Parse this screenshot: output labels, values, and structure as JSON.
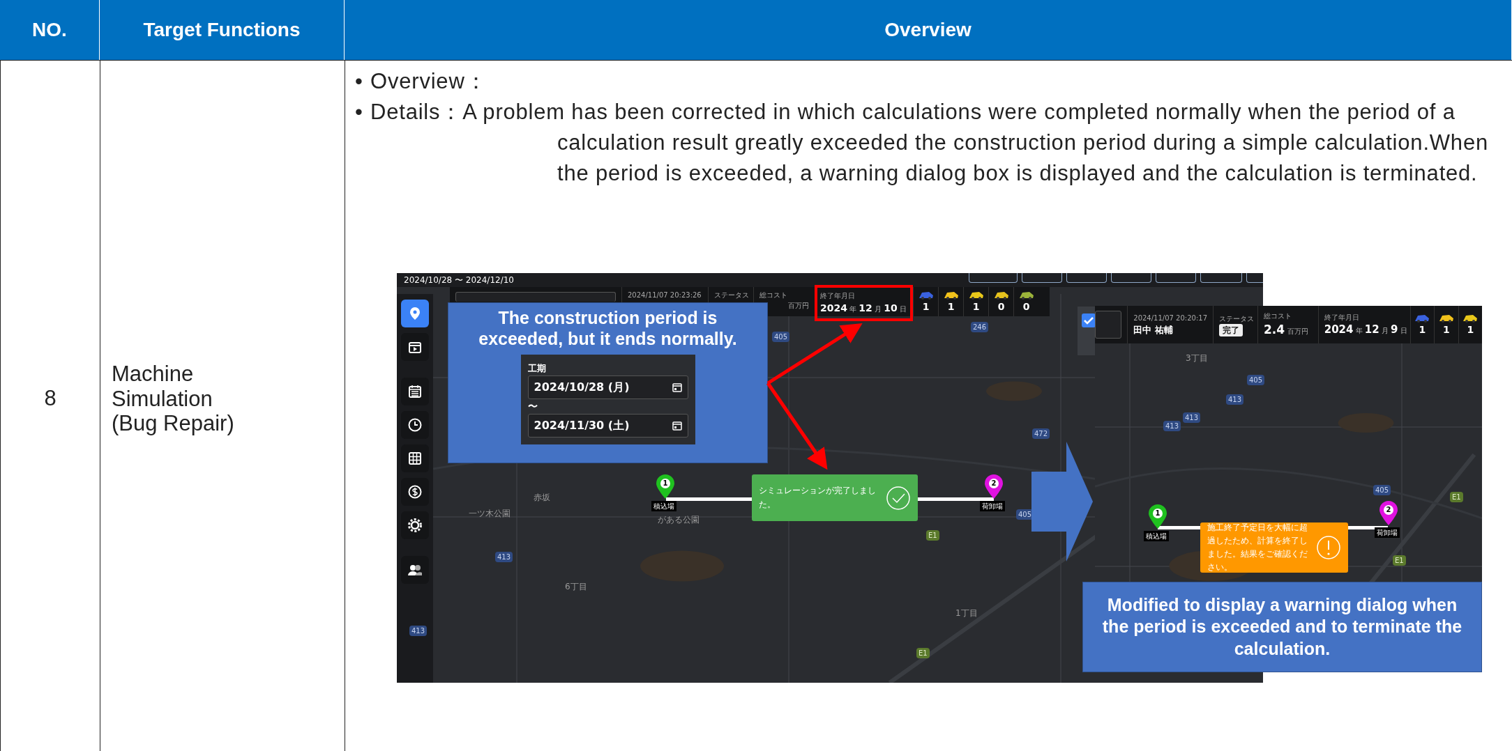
{
  "table": {
    "columns": [
      {
        "label": "NO."
      },
      {
        "label": "Target Functions"
      },
      {
        "label": "Overview"
      }
    ],
    "rows": [
      {
        "no": "8",
        "target_function": "Machine\nSimulation\n(Bug Repair)",
        "bullets": [
          {
            "marker": "•",
            "text": "Overview："
          },
          {
            "marker": "•",
            "text": "Details：A problem has been corrected in which calculations were completed normally when the period of a calculation result greatly exceeded the construction period during a simple calculation.When the period is exceeded, a warning dialog box is displayed and the calculation is terminated."
          }
        ],
        "figure": {
          "before_screen": {
            "date_range": "2024/10/28 〜 2024/12/10",
            "sidebar": [
              {
                "selected": true
              },
              {
                "selected": false
              },
              {
                "selected": false
              },
              {
                "selected": false
              },
              {
                "selected": false
              },
              {
                "selected": false
              },
              {
                "selected": false
              },
              {
                "selected": false
              }
            ],
            "header": {
              "timestamp": "2024/11/07 20:23:26",
              "status_label": "ステータス",
              "cost_label": "総コスト",
              "cost_unit": "百万円",
              "end_date_label": "終了年月日",
              "end_date": "**2024** 年 **12** 月 **10** 日",
              "machines": [
                {
                  "count": "1"
                },
                {
                  "count": "1"
                },
                {
                  "count": "1"
                },
                {
                  "count": "0"
                },
                {
                  "count": "0"
                }
              ]
            },
            "checkbox": {
              "checked": true
            },
            "map_labels": [
              {
                "text": "赤坂"
              },
              {
                "text": "一ツ木公園"
              },
              {
                "text": "6丁目"
              },
              {
                "text": "1丁目"
              },
              {
                "text": "がある公園"
              }
            ],
            "road_numbers": [
              {
                "text": "246"
              },
              {
                "text": "405"
              },
              {
                "text": "472"
              },
              {
                "text": "405"
              },
              {
                "text": "413"
              },
              {
                "text": "E1"
              },
              {
                "text": "413"
              },
              {
                "text": "E1"
              }
            ],
            "pins": [
              {
                "number": "1",
                "label": "積込場",
                "color": "#1fc11f"
              },
              {
                "number": "2",
                "label": "荷卸場",
                "color": "#e012e0"
              }
            ],
            "toast": {
              "kind": "success",
              "message": "シミュレーションが完了しました。"
            }
          },
          "callout_before": {
            "text": "The construction period is exceeded, but it ends normally.",
            "period": {
              "label": "工期",
              "start": "2024/10/28 (月)",
              "separator": "〜",
              "end": "2024/11/30 (土)"
            }
          },
          "after_screen": {
            "header": {
              "timestamp": "2024/11/07 20:20:17",
              "user": "田中 祐輔",
              "status_label": "ステータス",
              "status": "完了",
              "cost_label": "総コスト",
              "cost": "2.4",
              "cost_unit": "百万円",
              "end_date_label": "終了年月日",
              "end_date": "**2024** 年 **12** 月 **9** 日",
              "machines": [
                {
                  "count": "1"
                },
                {
                  "count": "1"
                },
                {
                  "count": "1"
                }
              ]
            },
            "map_labels": [
              {
                "text": "3丁目"
              }
            ],
            "road_numbers": [
              {
                "text": "405"
              },
              {
                "text": "413"
              },
              {
                "text": "413"
              },
              {
                "text": "413"
              },
              {
                "text": "405"
              },
              {
                "text": "E1"
              },
              {
                "text": "E1"
              }
            ],
            "pins": [
              {
                "number": "1",
                "label": "積込場",
                "color": "#1fc11f"
              },
              {
                "number": "2",
                "label": "荷卸場",
                "color": "#e012e0"
              }
            ],
            "toast": {
              "kind": "warning",
              "message": "施工終了予定日を大幅に超過したため、計算を終了しました。結果をご確認ください。"
            }
          },
          "callout_after": {
            "text": "Modified to display a warning dialog when the period is exceeded and to terminate the calculation."
          }
        }
      }
    ]
  }
}
